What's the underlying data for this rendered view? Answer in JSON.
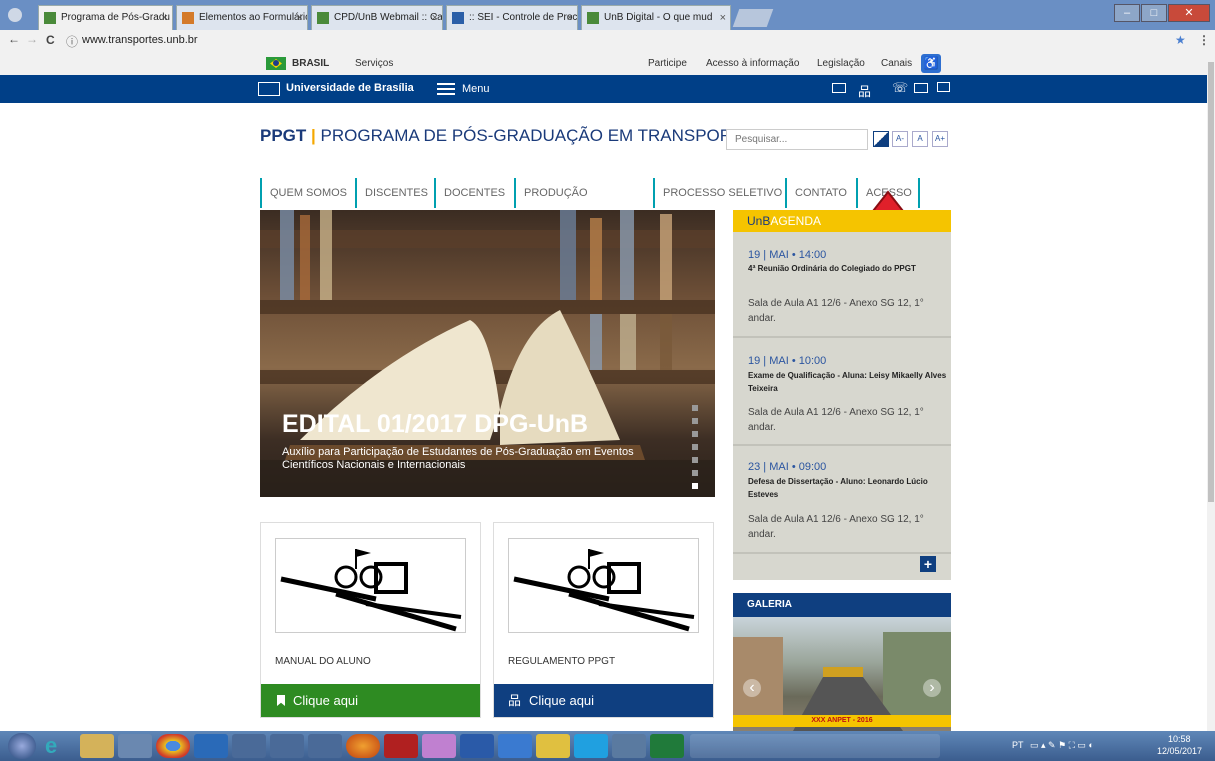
{
  "browser": {
    "tabs": [
      {
        "label": "Programa de Pós-Gradu",
        "active": true
      },
      {
        "label": "Elementos ao Formulário",
        "active": false
      },
      {
        "label": "CPD/UnB Webmail :: Ca",
        "active": false
      },
      {
        "label": ":: SEI - Controle de Proc",
        "active": false
      },
      {
        "label": "UnB Digital - O que mud",
        "active": false
      }
    ],
    "tab_close": "×",
    "url": "www.transportes.unb.br",
    "back": "←",
    "forward": "→",
    "reload": "C",
    "info": "ⓘ",
    "star": "★",
    "menu": "⋮"
  },
  "gov": {
    "brasil": "BRASIL",
    "servicos": "Serviços",
    "links": [
      "Participe",
      "Acesso à informação",
      "Legislação",
      "Canais"
    ]
  },
  "unb": {
    "name": "Universidade de Brasília",
    "menu": "Menu"
  },
  "site": {
    "acronym": "PPGT",
    "separator": "|",
    "title": "PROGRAMA DE PÓS-GRADUAÇÃO EM TRANSPORTES",
    "search_placeholder": "Pesquisar...",
    "font_buttons": [
      "A-",
      "A",
      "A+"
    ]
  },
  "nav": [
    "QUEM SOMOS",
    "DISCENTES",
    "DOCENTES",
    "PRODUÇÃO CIENTÍFICA",
    "PROCESSO SELETIVO",
    "CONTATO",
    "ACESSO"
  ],
  "hero": {
    "title": "EDITAL 01/2017 DPG-UnB",
    "subtitle": "Auxílio para Participação de Estudantes de Pós-Graduação em Eventos Científicos Nacionais e Internacionais",
    "slide_count": 7,
    "active_slide": 7
  },
  "agenda": {
    "title_bold": "UnB",
    "title_rest": "AGENDA",
    "items": [
      {
        "date": "19 | MAI • 14:00",
        "title": "4ª Reunião Ordinária do Colegiado do PPGT",
        "place": "Sala de Aula A1 12/6 - Anexo SG 12, 1° andar."
      },
      {
        "date": "19 | MAI • 10:00",
        "title": "Exame de Qualificação - Aluna: Leisy Mikaelly Alves Teixeira",
        "place": "Sala de Aula A1 12/6 - Anexo SG 12, 1° andar."
      },
      {
        "date": "23 | MAI • 09:00",
        "title": "Defesa de Dissertação - Aluno: Leonardo Lúcio Esteves",
        "place": "Sala de Aula A1 12/6 - Anexo SG 12, 1° andar."
      }
    ],
    "more": "+"
  },
  "cards": [
    {
      "label": "MANUAL DO ALUNO",
      "button": "Clique aqui",
      "color": "#2e8b22"
    },
    {
      "label": "REGULAMENTO PPGT",
      "button": "Clique aqui",
      "color": "#0f3f80"
    }
  ],
  "galeria": {
    "title": "GALERIA",
    "caption": "XXX ANPET - 2016",
    "prev": "‹",
    "next": "›"
  },
  "taskbar": {
    "lang": "PT",
    "time": "10:58",
    "date": "12/05/2017"
  },
  "colors": {
    "unb_blue": "#003f87",
    "agenda_yellow": "#f5c400",
    "nav_accent": "#00a0b0",
    "arrow_red": "#e0202a"
  }
}
